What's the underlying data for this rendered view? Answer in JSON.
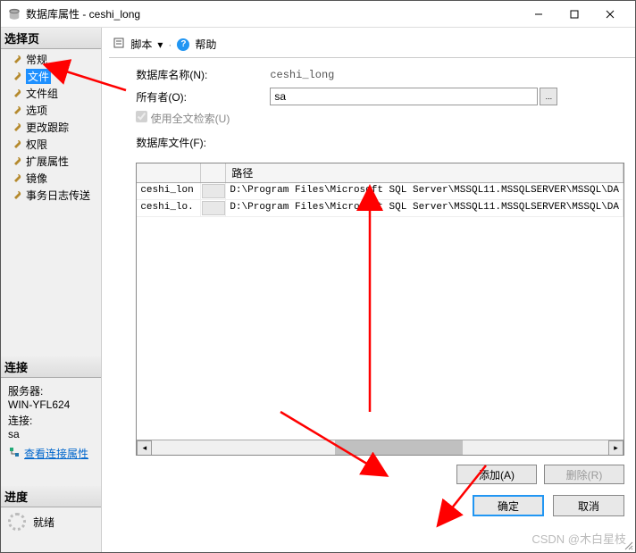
{
  "window": {
    "title": "数据库属性 - ceshi_long",
    "min_icon": "minimize",
    "max_icon": "maximize",
    "close_icon": "close"
  },
  "sidebar": {
    "select_page_title": "选择页",
    "items": [
      {
        "label": "常规",
        "selected": false
      },
      {
        "label": "文件",
        "selected": true
      },
      {
        "label": "文件组",
        "selected": false
      },
      {
        "label": "选项",
        "selected": false
      },
      {
        "label": "更改跟踪",
        "selected": false
      },
      {
        "label": "权限",
        "selected": false
      },
      {
        "label": "扩展属性",
        "selected": false
      },
      {
        "label": "镜像",
        "selected": false
      },
      {
        "label": "事务日志传送",
        "selected": false
      }
    ],
    "connection_title": "连接",
    "server_label": "服务器:",
    "server_value": "WIN-YFL624",
    "conn_label": "连接:",
    "conn_value": "sa",
    "view_conn_link": "查看连接属性",
    "progress_title": "进度",
    "progress_status": "就绪"
  },
  "toolbar": {
    "script_label": "脚本",
    "help_label": "帮助"
  },
  "form": {
    "db_name_label": "数据库名称(N):",
    "db_name_value": "ceshi_long",
    "owner_label": "所有者(O):",
    "owner_value": "sa",
    "browse_btn": "...",
    "fulltext_label": "使用全文检索(U)",
    "files_label": "数据库文件(F):"
  },
  "grid": {
    "columns": {
      "path": "路径"
    },
    "rows": [
      {
        "name": "ceshi_lon",
        "path": "D:\\Program Files\\Microsoft SQL Server\\MSSQL11.MSSQLSERVER\\MSSQL\\DA"
      },
      {
        "name": "ceshi_lo.",
        "path": "D:\\Program Files\\Microsoft SQL Server\\MSSQL11.MSSQLSERVER\\MSSQL\\DA"
      }
    ]
  },
  "buttons": {
    "add": "添加(A)",
    "delete": "删除(R)",
    "ok": "确定",
    "cancel": "取消"
  },
  "watermark": "CSDN @木白星枝"
}
